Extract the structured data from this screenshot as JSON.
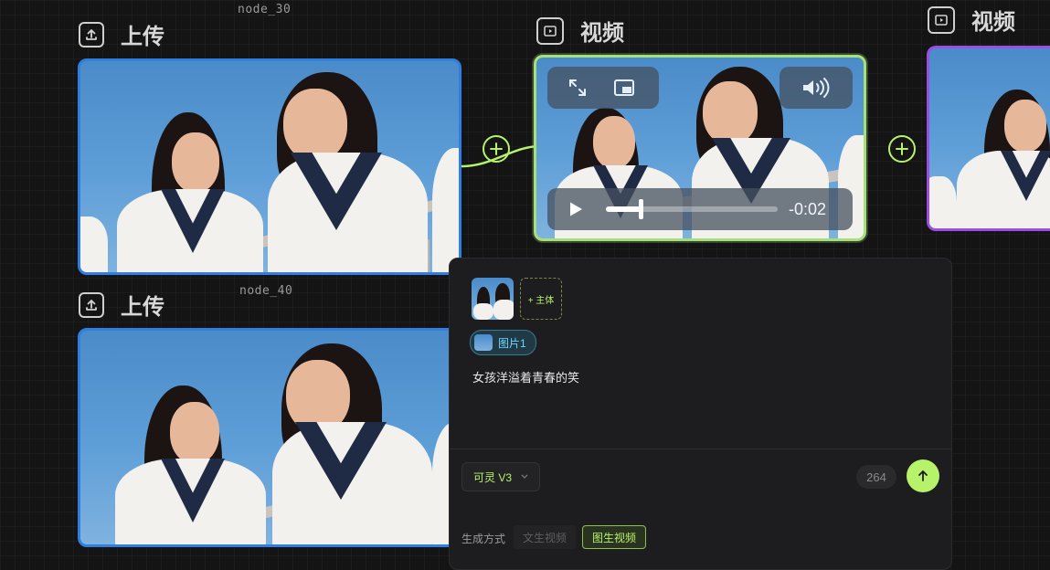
{
  "nodes": {
    "upload_1": {
      "id": "node_30",
      "title": "上传"
    },
    "upload_2": {
      "id": "node_40",
      "title": "上传"
    },
    "video_1": {
      "title": "视频",
      "time_remaining": "-0:02",
      "progress": 0.2
    },
    "video_2": {
      "title": "视频"
    }
  },
  "panel": {
    "add_subject_label": "+ 主体",
    "reference_tag": "图片1",
    "prompt_text": "女孩洋溢着青春的笑",
    "model_label": "可灵 V3",
    "credit_count": "264",
    "mode_label": "生成方式",
    "mode_options": [
      "文生视频",
      "图生视频"
    ],
    "mode_selected": "图生视频"
  },
  "colors": {
    "accent_green": "#b7f36a",
    "upload_border": "#2f7fe0",
    "video_border": "#a7e07a",
    "purple_border": "#9a4fe0",
    "tag_cyan": "#6fd7ff"
  },
  "icons": {
    "upload": "upload-icon",
    "video": "video-icon",
    "expand": "expand-icon",
    "pip": "picture-in-picture-icon",
    "volume": "volume-icon",
    "play": "play-icon",
    "add": "plus-icon",
    "chevron": "chevron-down-icon",
    "send": "arrow-up-icon"
  }
}
